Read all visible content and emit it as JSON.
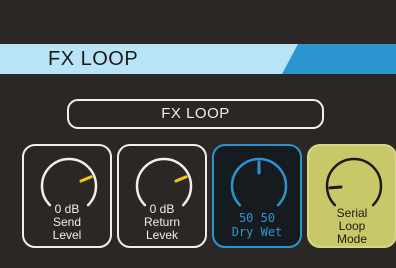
{
  "header": {
    "title": "FX LOOP"
  },
  "section": {
    "label": "FX LOOP"
  },
  "knobs": [
    {
      "value": "0 dB",
      "line1": "Send",
      "line2": "Level",
      "level": 0.75
    },
    {
      "value": "0 dB",
      "line1": "Return",
      "line2": "Levek",
      "level": 0.75
    },
    {
      "value": "50 50",
      "line1": "Dry Wet",
      "level": 0.5
    },
    {
      "line1": "Serial",
      "line2": "Loop",
      "line3": "Mode",
      "level": 0.15
    }
  ],
  "colors": {
    "background": "#2a2725",
    "header_light": "#b8e4f6",
    "header_accent": "#2d94d2",
    "outline": "#f1efe9",
    "indicator": "#f0c419",
    "active": "#2d94d2",
    "mode_fill": "#c9c869"
  }
}
